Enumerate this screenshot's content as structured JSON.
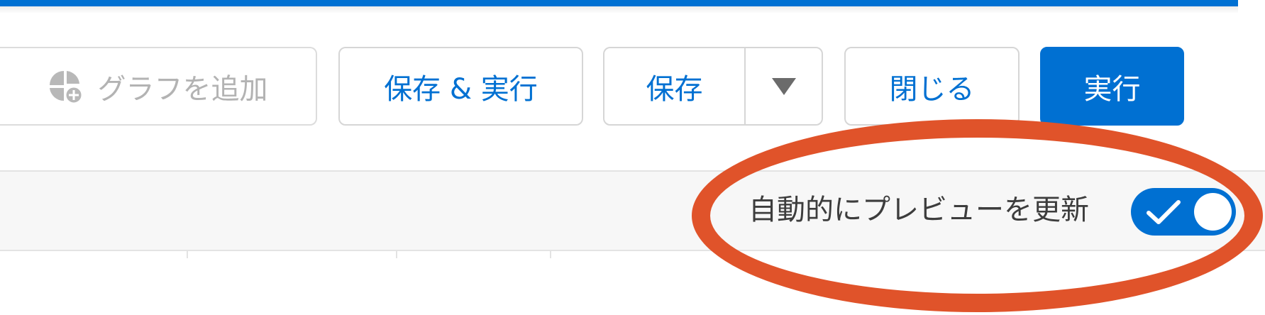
{
  "colors": {
    "accent": "#0070d2",
    "annotation": "#e0532a"
  },
  "icons": {
    "add_chart": "chart-add-icon",
    "dropdown": "caret-down-icon",
    "toggle_check": "check-icon"
  },
  "toolbar": {
    "add_chart_label": "グラフを追加",
    "save_run_label": "保存 & 実行",
    "save_label": "保存",
    "close_label": "閉じる",
    "run_label": "実行"
  },
  "preview": {
    "auto_update_label": "自動的にプレビューを更新",
    "auto_update_enabled": true
  }
}
